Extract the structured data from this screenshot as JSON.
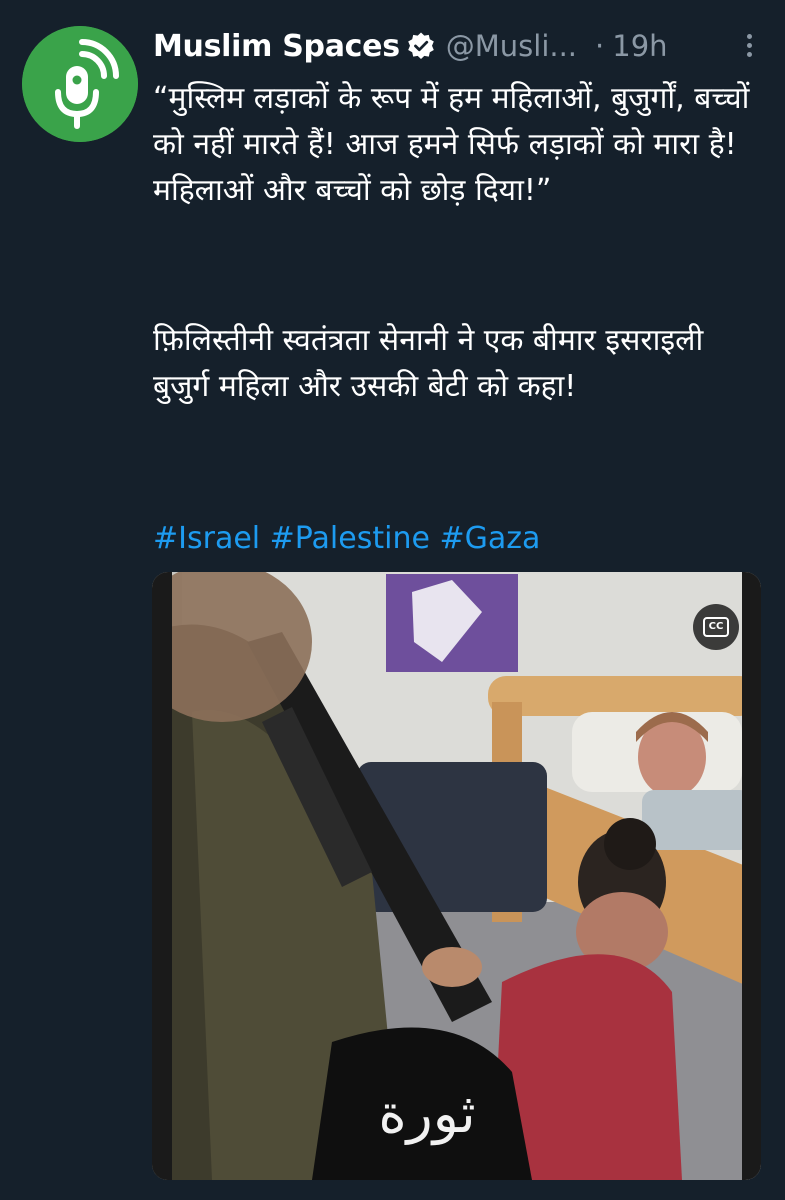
{
  "account": {
    "name": "Muslim Spaces",
    "handle": "@Musli...",
    "separator": "·",
    "time": "19h",
    "verified": true,
    "avatar_color": "#3aa34a"
  },
  "tweet": {
    "quote": "“मुस्लिम लड़ाकों के रूप में हम महिलाओं, बुजुर्गों, बच्चों को नहीं मारते हैं! आज हमने सिर्फ लड़ाकों को मारा है! महिलाओं और बच्चों को छोड़ दिया!”",
    "paragraph": "फ़िलिस्तीनी स्वतंत्रता सेनानी ने एक बीमार इसराइली बुजुर्ग महिला और उसकी बेटी को कहा!",
    "hashtags": [
      "#Israel",
      "#Palestine",
      "#Gaza"
    ]
  },
  "media": {
    "type": "video",
    "cc_label": "CC",
    "overlay_text": "ثورة"
  },
  "colors": {
    "background": "#15202b",
    "text": "#ffffff",
    "muted": "#8b98a5",
    "link": "#1d9bf0"
  },
  "icons": [
    "podcast-mic-icon",
    "verified-badge-icon",
    "more-options-icon",
    "closed-captions-icon"
  ]
}
